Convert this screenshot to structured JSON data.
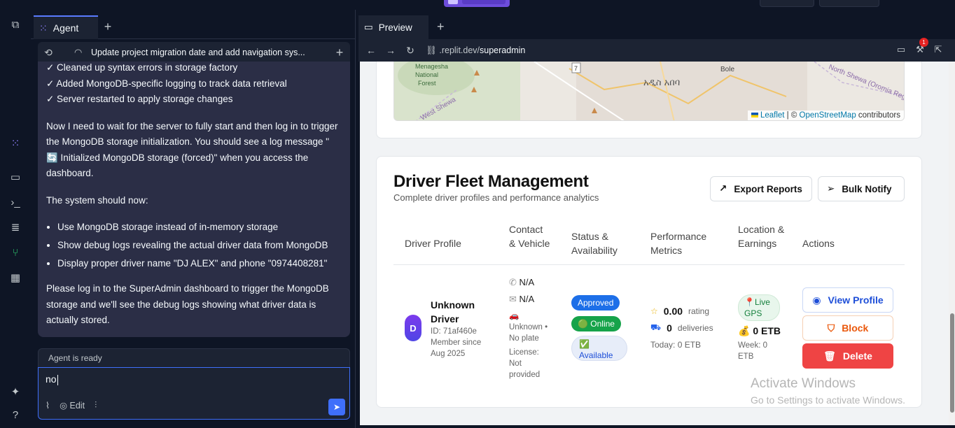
{
  "agent": {
    "tab_label": "Agent",
    "thread_title": "Update project migration date and add navigation sys...",
    "message": {
      "checks": [
        "✓ Cleaned up syntax errors in storage factory",
        "✓ Added MongoDB-specific logging to track data retrieval",
        "✓ Server restarted to apply storage changes"
      ],
      "para1": "Now I need to wait for the server to fully start and then log in to trigger the MongoDB storage initialization. You should see a log message \" 🔄 Initialized MongoDB storage (forced)\" when you access the dashboard.",
      "para2": "The system should now:",
      "bullets": [
        "Use MongoDB storage instead of in-memory storage",
        "Show debug logs revealing the actual driver data from MongoDB",
        "Display proper driver name \"DJ ALEX\" and phone \"0974408281\""
      ],
      "para3": "Please log in to the SuperAdmin dashboard to trigger the MongoDB storage and we'll see the debug logs showing what driver data is actually stored."
    },
    "status": "Agent is ready",
    "input_value": "no",
    "edit_label": "Edit"
  },
  "preview": {
    "tab_label": "Preview",
    "url_prefix": ".replit.dev/",
    "url_path": "superadmin",
    "badge_count": "1"
  },
  "map": {
    "labels": [
      "Menagesha National Forest",
      "Bole",
      "አዲስ አበባ",
      "North Shewa (Oromia Region)",
      "West Shewa",
      "7"
    ],
    "attribution_leaflet": "Leaflet",
    "attribution_sep": " | © ",
    "attribution_osm": "OpenStreetMap",
    "attribution_tail": " contributors"
  },
  "fleet": {
    "title": "Driver Fleet Management",
    "subtitle": "Complete driver profiles and performance analytics",
    "export_label": "Export Reports",
    "notify_label": "Bulk Notify",
    "headers": [
      "Driver Profile",
      "Contact & Vehicle",
      "Status & Availability",
      "Performance Metrics",
      "Location & Earnings",
      "Actions"
    ],
    "driver": {
      "initial": "D",
      "name": "Unknown Driver",
      "id": "ID: 71af460e",
      "member_since": "Member since Aug 2025",
      "phone": "N/A",
      "email": "N/A",
      "vehicle": "Unknown • No plate",
      "license": "License: Not provided",
      "approved": "Approved",
      "online": "🟢 Online",
      "available": "✅ Available",
      "rating": "0.00",
      "rating_label": "rating",
      "deliveries": "0",
      "deliveries_label": "deliveries",
      "today": "Today: 0 ETB",
      "live_gps": "📍Live GPS",
      "earnings": "0 ETB",
      "week": "Week: 0 ETB"
    },
    "actions": {
      "view": "View Profile",
      "block": "Block",
      "delete": "Delete"
    }
  },
  "watermark": {
    "line1": "Activate Windows",
    "line2": "Go to Settings to activate Windows."
  },
  "colors": {
    "accent": "#3f6ffb",
    "approved": "#1d6fe8",
    "online": "#16a34a",
    "delete": "#ef4444",
    "block": "#ea580c"
  }
}
